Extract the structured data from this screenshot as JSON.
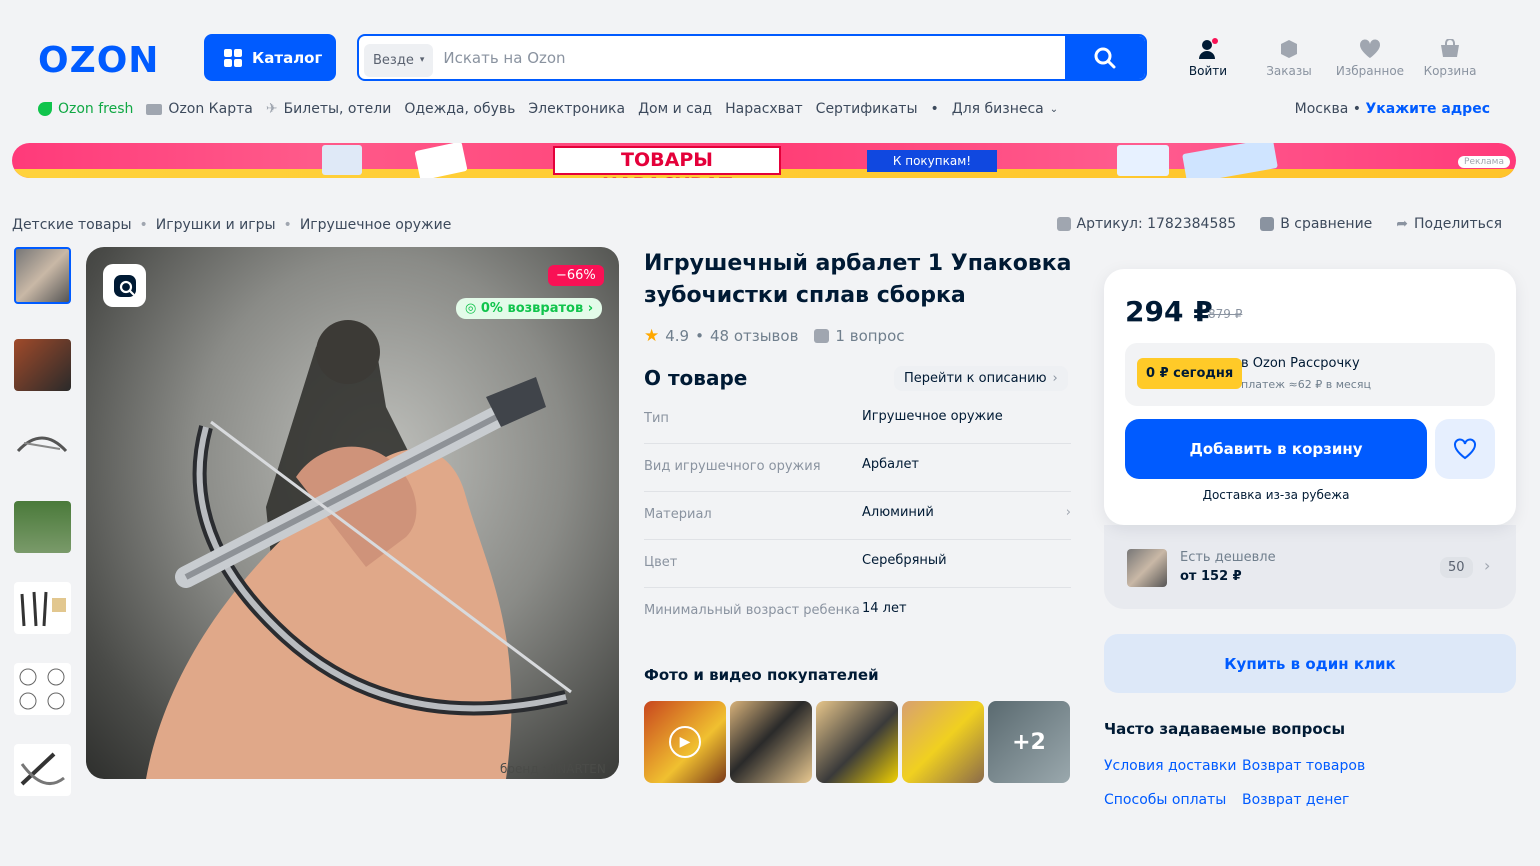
{
  "header": {
    "logo": "OZON",
    "catalog": "Каталог",
    "search_scope": "Везде",
    "search_placeholder": "Искать на Ozon",
    "icons": [
      {
        "name": "user-icon",
        "label": "Войти"
      },
      {
        "name": "orders-icon",
        "label": "Заказы"
      },
      {
        "name": "heart-icon",
        "label": "Избранное"
      },
      {
        "name": "cart-icon",
        "label": "Корзина"
      }
    ]
  },
  "nav": [
    "Ozon fresh",
    "Ozon Карта",
    "Билеты, отели",
    "Одежда, обувь",
    "Электроника",
    "Дом и сад",
    "Нарасхват",
    "Сертификаты",
    "Для бизнеса"
  ],
  "address": {
    "city": "Москва",
    "link": "Укажите адрес"
  },
  "banner": {
    "title": "ТОВАРЫ НАРАСХВАТ",
    "button": "К покупкам!",
    "ad": "Реклама"
  },
  "breadcrumbs": [
    "Детские товары",
    "Игрушки и игры",
    "Игрушечное оружие"
  ],
  "tools": {
    "article": "Артикул: 1782384585",
    "compare": "В сравнение",
    "share": "Поделиться"
  },
  "gallery": {
    "discount": "−66%",
    "returns": "0% возвратов",
    "brand": "бренд : JINARTEN"
  },
  "product": {
    "title": "Игрушечный арбалет 1 Упаковка зубочистки сплав сборка",
    "rating": "4.9",
    "reviews": "48 отзывов",
    "questions": "1 вопрос",
    "about": "О товаре",
    "go_desc": "Перейти к описанию",
    "specs": [
      {
        "k": "Тип",
        "v": "Игрушечное оружие"
      },
      {
        "k": "Вид игрушечного оружия",
        "v": "Арбалет"
      },
      {
        "k": "Материал",
        "v": "Алюминий"
      },
      {
        "k": "Цвет",
        "v": "Серебряный"
      },
      {
        "k": "Минимальный возраст ребенка",
        "v": "14 лет"
      }
    ],
    "photos_title": "Фото и видео покупателей",
    "photos_more": "+2"
  },
  "buy": {
    "price": "294 ₽",
    "old_price": "879 ₽",
    "zero_today": "0 ₽ сегодня",
    "install_title": "в Ozon Рассрочку",
    "install_sub": "платеж ≈62 ₽ в месяц",
    "add": "Добавить в корзину",
    "delivery": "Доставка из-за рубежа",
    "cheaper_title": "Есть дешевле",
    "cheaper_price": "от 152 ₽",
    "cheaper_count": "50",
    "one_click": "Купить в один клик"
  },
  "faq": {
    "title": "Часто задаваемые вопросы",
    "links": [
      "Условия доставки",
      "Возврат товаров",
      "Способы оплаты",
      "Возврат денег"
    ]
  }
}
